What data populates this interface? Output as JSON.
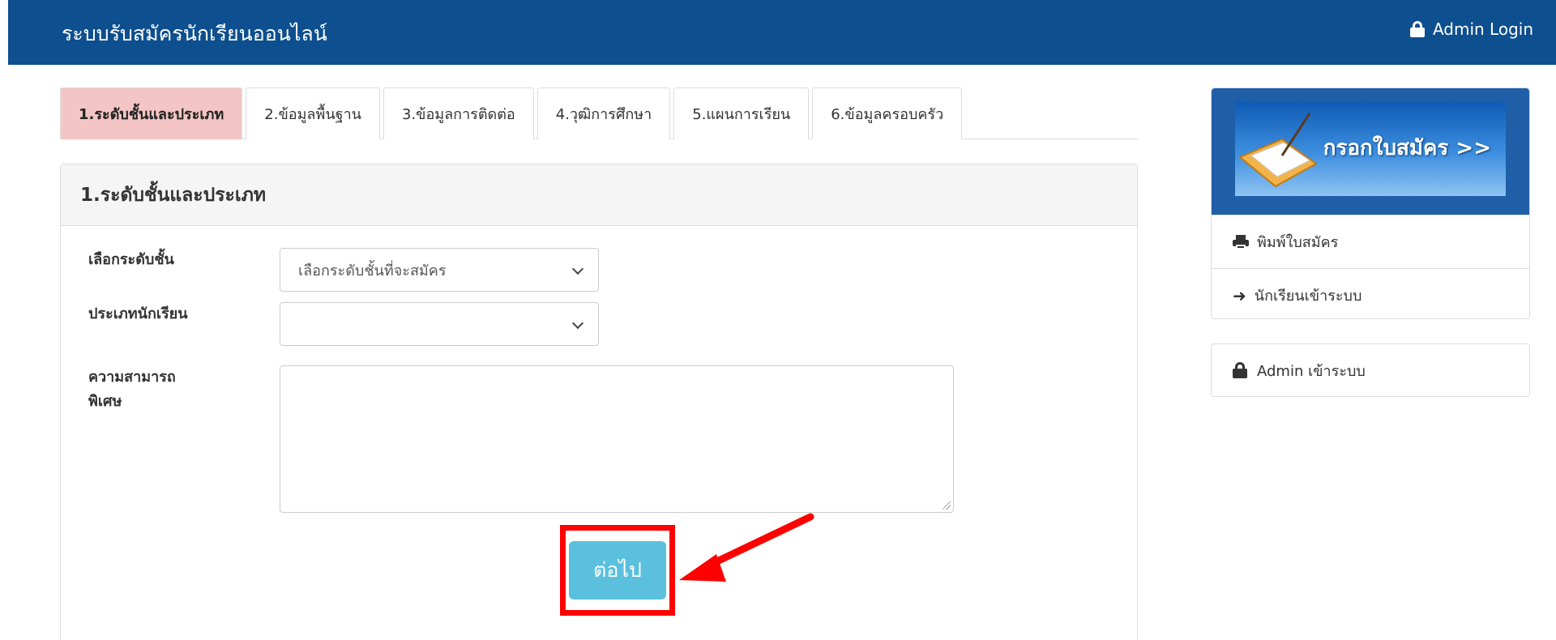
{
  "navbar": {
    "brand": "ระบบรับสมัครนักเรียนออนไลน์",
    "admin_login": "Admin Login",
    "admin_login_icon": "lock-icon"
  },
  "tabs": [
    {
      "label": "1.ระดับชั้นและประเภท",
      "active": true
    },
    {
      "label": "2.ข้อมูลพื้นฐาน",
      "active": false
    },
    {
      "label": "3.ข้อมูลการติดต่อ",
      "active": false
    },
    {
      "label": "4.วุฒิการศึกษา",
      "active": false
    },
    {
      "label": "5.แผนการเรียน",
      "active": false
    },
    {
      "label": "6.ข้อมูลครอบครัว",
      "active": false
    }
  ],
  "panel": {
    "heading": "1.ระดับชั้นและประเภท",
    "fields": {
      "level_label": "เลือกระดับชั้น",
      "level_value": "เลือกระดับชั้นที่จะสมัคร",
      "student_type_label": "ประเภทนักเรียน",
      "student_type_value": "",
      "special_ability_label_line1": "ความสามารถ",
      "special_ability_label_line2": "พิเศษ",
      "special_ability_value": ""
    },
    "next_button": "ต่อไป"
  },
  "sidebar": {
    "banner_text": "กรอกใบสมัคร >>",
    "items": [
      {
        "label": "พิมพ์ใบสมัคร",
        "icon": "print-icon"
      },
      {
        "label": "นักเรียนเข้าระบบ",
        "icon": "sign-in-icon"
      }
    ],
    "admin_item": {
      "label": "Admin เข้าระบบ",
      "icon": "lock-icon"
    }
  },
  "colors": {
    "navbar": "#0d4f8f",
    "active_tab": "#f4c5c5",
    "next_button": "#5bc0de",
    "annotation": "#ff0000"
  }
}
